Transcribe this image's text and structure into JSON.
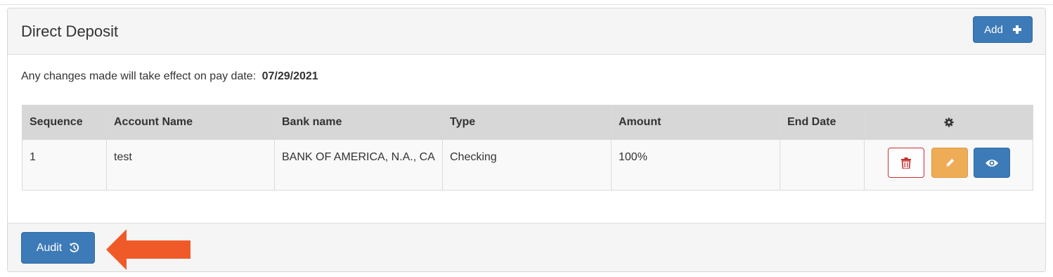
{
  "panel": {
    "title": "Direct Deposit",
    "add_label": "Add",
    "notice_text": "Any changes made will take effect on pay date:",
    "pay_date": "07/29/2021"
  },
  "table": {
    "headers": [
      "Sequence",
      "Account Name",
      "Bank name",
      "Type",
      "Amount",
      "End Date"
    ],
    "actions_header_icon": "gear-icon",
    "rows": [
      {
        "sequence": "1",
        "account_name": "test",
        "bank_name": "BANK OF AMERICA, N.A., CA",
        "type": "Checking",
        "amount": "100%",
        "end_date": ""
      }
    ],
    "row_actions": [
      "trash-icon",
      "pencil-icon",
      "eye-icon"
    ]
  },
  "footer": {
    "audit_label": "Audit",
    "audit_icon": "history-icon"
  },
  "colors": {
    "primary": "#3d7ab8",
    "danger": "#c9302c",
    "warning": "#eeac57",
    "annotation_arrow": "#f05a28"
  }
}
